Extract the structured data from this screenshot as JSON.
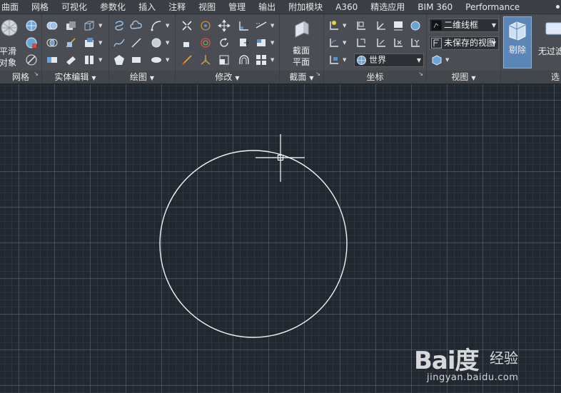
{
  "menu": {
    "items": [
      "曲面",
      "网格",
      "可视化",
      "参数化",
      "插入",
      "注释",
      "视图",
      "管理",
      "输出",
      "附加模块",
      "A360",
      "精选应用",
      "BIM 360",
      "Performance"
    ]
  },
  "ribbon": {
    "panels": {
      "mesh": {
        "title": "网格",
        "smooth_label_1": "平滑",
        "smooth_label_2": "对象"
      },
      "solid_edit": {
        "title": "实体编辑"
      },
      "draw": {
        "title": "绘图"
      },
      "modify": {
        "title": "修改"
      },
      "section": {
        "title": "截面",
        "plane_label_1": "截面",
        "plane_label_2": "平面"
      },
      "coordinates": {
        "title": "坐标",
        "ucs_combo": "世界"
      },
      "view": {
        "title": "视图",
        "visual_style_combo": "二维线框",
        "named_view_combo": "未保存的视图"
      },
      "selection": {
        "cull_label": "剔除",
        "no_filter_label": "无过滤"
      },
      "partial_title": "选"
    },
    "accent_color": "#5b86b8"
  },
  "canvas": {
    "background_color": "#212830",
    "circle_color": "#f2f2f2",
    "crosshair_color": "#ffffff"
  },
  "watermark": {
    "logo": "Bai度",
    "brand_cn": "经验",
    "url": "jingyan.baidu.com"
  }
}
